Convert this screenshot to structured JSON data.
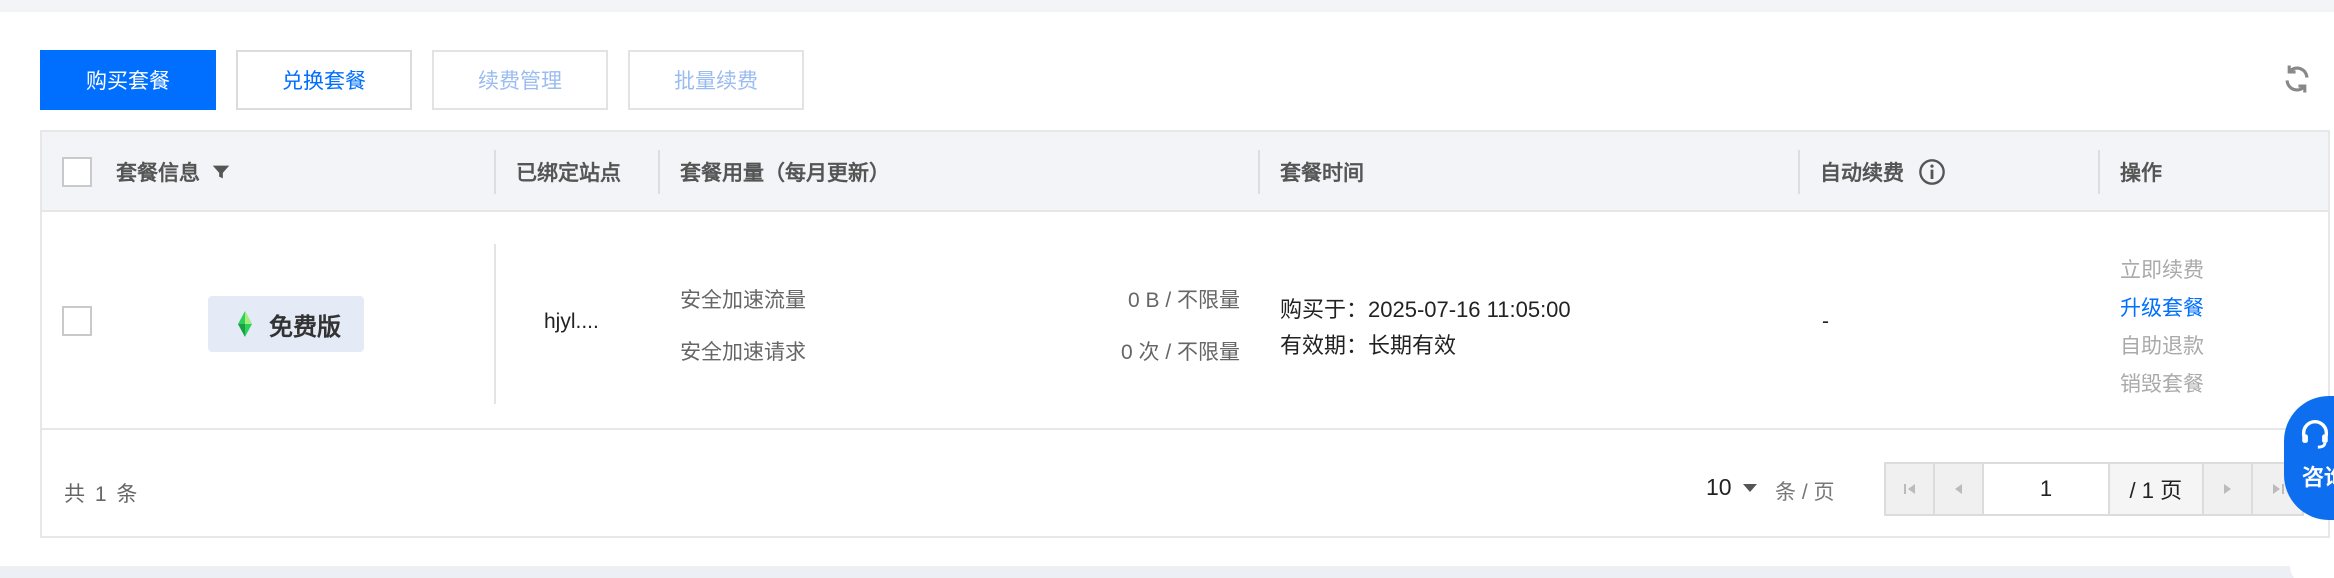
{
  "toolbar": {
    "buy_label": "购买套餐",
    "exchange_label": "兑换套餐",
    "renew_manage_label": "续费管理",
    "batch_renew_label": "批量续费"
  },
  "table": {
    "headers": {
      "plan_info": "套餐信息",
      "bound_sites": "已绑定站点",
      "usage": "套餐用量（每月更新）",
      "time": "套餐时间",
      "auto_renew": "自动续费",
      "actions": "操作"
    },
    "rows": [
      {
        "plan_badge": "免费版",
        "site": "hjyl....",
        "usage": [
          {
            "label": "安全加速流量",
            "value": "0 B / 不限量"
          },
          {
            "label": "安全加速请求",
            "value": "0 次 / 不限量"
          }
        ],
        "purchase_time": "购买于：2025-07-16 11:05:00",
        "validity": "有效期：长期有效",
        "auto_renew": "-",
        "actions": {
          "renew_now": "立即续费",
          "upgrade": "升级套餐",
          "refund": "自助退款",
          "destroy": "销毁套餐"
        }
      }
    ]
  },
  "footer": {
    "total": "共 1 条",
    "page_size": "10",
    "per_page_label": "条 / 页",
    "current_page": "1",
    "total_pages": "/ 1 页"
  },
  "consult": {
    "label": "咨询"
  },
  "icons": {
    "filter": "filter-icon",
    "info": "info-icon",
    "refresh": "refresh-icon",
    "badge": "diamond-logo-icon",
    "first": "first-page-icon",
    "prev": "prev-page-icon",
    "next": "next-page-icon",
    "last": "last-page-icon",
    "support": "headset-icon"
  },
  "colors": {
    "primary": "#006eff",
    "badge_bg": "#e5ebf6",
    "logo_green": "#2fd05a"
  }
}
